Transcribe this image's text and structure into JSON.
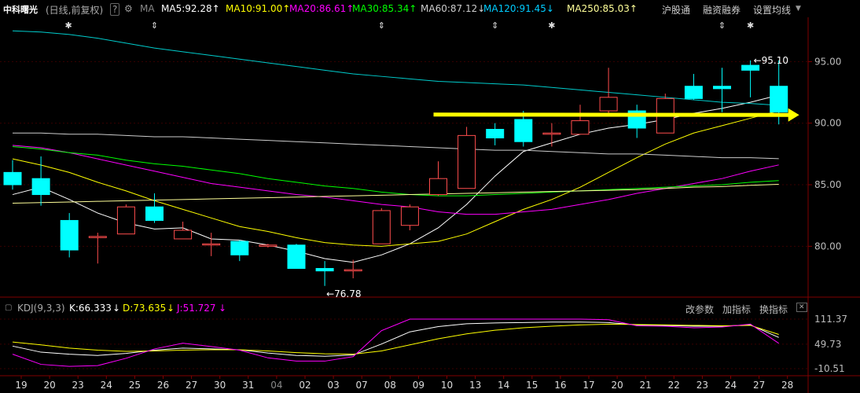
{
  "header": {
    "title": "中科曙光",
    "mode": "(日线,前复权)",
    "help_icon": "?",
    "settings_icon": "gear-icon",
    "ma_label": "MA",
    "ma": [
      {
        "label": "MA5:92.28",
        "arrow": "↑",
        "color": "#ffffff"
      },
      {
        "label": "MA10:91.00",
        "arrow": "↑",
        "color": "#ffff00"
      },
      {
        "label": "MA20:86.61",
        "arrow": "↑",
        "color": "#ff00ff"
      },
      {
        "label": "MA30:85.34",
        "arrow": "↑",
        "color": "#00ff00"
      },
      {
        "label": "MA60:87.12",
        "arrow": "↓",
        "color": "#cccccc"
      },
      {
        "label": "MA120:91.45",
        "arrow": "↓",
        "color": "#00ccff"
      },
      {
        "label": "MA250:85.03",
        "arrow": "↑",
        "color": "#ffff99"
      }
    ],
    "links": [
      "沪股通",
      "融资融券",
      "设置均线"
    ]
  },
  "indicator": {
    "name": "KDJ(9,3,3)",
    "k": "K:66.333",
    "k_arrow": "↓",
    "d": "D:73.635",
    "d_arrow": "↓",
    "j": "J:51.727",
    "j_arrow": "↓",
    "buttons": [
      "改参数",
      "加指标",
      "换指标"
    ]
  },
  "colors": {
    "up": "#ff4d4d",
    "down": "#00ffff",
    "arrow": "#ffff00"
  },
  "chart_data": {
    "type": "candlestick",
    "x_labels": [
      "19",
      "20",
      "23",
      "24",
      "25",
      "26",
      "27",
      "30",
      "31",
      "04",
      "02",
      "03",
      "07",
      "08",
      "09",
      "10",
      "13",
      "14",
      "15",
      "16",
      "17",
      "20",
      "21",
      "22",
      "23",
      "24",
      "27",
      "28"
    ],
    "y_ticks": [
      80.0,
      85.0,
      90.0,
      95.0
    ],
    "ylim": [
      76.0,
      98.6
    ],
    "annotations": {
      "max": "95.10",
      "min": "76.78",
      "max_arrow": "←",
      "min_arrow": "←"
    },
    "markers": [
      "✱",
      "⇕",
      "⇕",
      "⇕",
      "✱",
      "⇕",
      "✱"
    ],
    "candles": [
      {
        "o": 86.0,
        "h": 87.0,
        "l": 84.6,
        "c": 85.0
      },
      {
        "o": 85.5,
        "h": 87.3,
        "l": 83.3,
        "c": 84.2
      },
      {
        "o": 82.1,
        "h": 82.7,
        "l": 79.1,
        "c": 79.7
      },
      {
        "o": 80.8,
        "h": 81.1,
        "l": 78.6,
        "c": 80.8
      },
      {
        "o": 81.0,
        "h": 83.4,
        "l": 81.0,
        "c": 83.2
      },
      {
        "o": 83.2,
        "h": 84.3,
        "l": 81.9,
        "c": 82.1
      },
      {
        "o": 80.6,
        "h": 82.0,
        "l": 80.6,
        "c": 81.3
      },
      {
        "o": 80.2,
        "h": 81.1,
        "l": 79.2,
        "c": 80.2
      },
      {
        "o": 80.4,
        "h": 80.5,
        "l": 78.8,
        "c": 79.3
      },
      {
        "o": 80.0,
        "h": 80.2,
        "l": 79.9,
        "c": 80.1
      },
      {
        "o": 80.1,
        "h": 80.2,
        "l": 78.2,
        "c": 78.2
      },
      {
        "o": 78.2,
        "h": 78.8,
        "l": 76.78,
        "c": 78.0
      },
      {
        "o": 78.0,
        "h": 78.9,
        "l": 77.4,
        "c": 78.1
      },
      {
        "o": 80.2,
        "h": 83.1,
        "l": 80.2,
        "c": 82.9
      },
      {
        "o": 81.7,
        "h": 83.4,
        "l": 81.3,
        "c": 83.2
      },
      {
        "o": 84.2,
        "h": 86.9,
        "l": 84.1,
        "c": 85.5
      },
      {
        "o": 84.7,
        "h": 89.7,
        "l": 84.7,
        "c": 89.0
      },
      {
        "o": 89.5,
        "h": 90.0,
        "l": 88.2,
        "c": 88.8
      },
      {
        "o": 90.3,
        "h": 91.0,
        "l": 88.1,
        "c": 88.5
      },
      {
        "o": 89.1,
        "h": 90.0,
        "l": 88.1,
        "c": 89.2
      },
      {
        "o": 89.1,
        "h": 91.5,
        "l": 89.1,
        "c": 90.2
      },
      {
        "o": 91.0,
        "h": 94.5,
        "l": 90.7,
        "c": 92.1
      },
      {
        "o": 91.0,
        "h": 91.5,
        "l": 88.8,
        "c": 89.6
      },
      {
        "o": 89.2,
        "h": 92.4,
        "l": 89.2,
        "c": 92.0
      },
      {
        "o": 93.0,
        "h": 94.0,
        "l": 91.9,
        "c": 92.0
      },
      {
        "o": 93.0,
        "h": 94.5,
        "l": 90.9,
        "c": 92.8
      },
      {
        "o": 94.7,
        "h": 95.1,
        "l": 92.1,
        "c": 94.3
      },
      {
        "o": 93.0,
        "h": 95.1,
        "l": 89.9,
        "c": 90.9
      }
    ],
    "ma_lines": {
      "MA5": [
        84.2,
        84.8,
        83.8,
        82.7,
        81.9,
        81.4,
        81.5,
        80.6,
        80.5,
        80.1,
        79.6,
        79.0,
        78.7,
        79.3,
        80.2,
        81.5,
        83.4,
        85.7,
        87.7,
        88.4,
        89.1,
        89.6,
        89.9,
        90.3,
        90.8,
        91.2,
        91.7,
        92.28
      ],
      "MA10": [
        87.1,
        86.6,
        86.0,
        85.2,
        84.5,
        83.7,
        83.0,
        82.3,
        81.6,
        81.2,
        80.7,
        80.3,
        80.1,
        80.0,
        80.2,
        80.4,
        81.0,
        82.0,
        83.0,
        83.8,
        84.8,
        86.0,
        87.2,
        88.3,
        89.2,
        89.8,
        90.4,
        91.0
      ],
      "MA20": [
        88.2,
        88.0,
        87.6,
        87.1,
        86.6,
        86.1,
        85.6,
        85.1,
        84.8,
        84.5,
        84.2,
        84.0,
        83.7,
        83.4,
        83.2,
        82.8,
        82.6,
        82.6,
        82.8,
        83.0,
        83.4,
        83.8,
        84.3,
        84.7,
        85.1,
        85.5,
        86.1,
        86.61
      ],
      "MA30": [
        88.1,
        87.9,
        87.6,
        87.4,
        87.0,
        86.7,
        86.5,
        86.2,
        85.9,
        85.5,
        85.2,
        84.9,
        84.7,
        84.4,
        84.2,
        84.1,
        84.1,
        84.2,
        84.3,
        84.4,
        84.5,
        84.6,
        84.7,
        84.8,
        84.9,
        85.0,
        85.2,
        85.34
      ],
      "MA60": [
        89.2,
        89.2,
        89.1,
        89.1,
        89.0,
        88.9,
        88.9,
        88.8,
        88.7,
        88.6,
        88.5,
        88.4,
        88.3,
        88.2,
        88.1,
        88.0,
        87.9,
        87.8,
        87.8,
        87.7,
        87.6,
        87.5,
        87.5,
        87.4,
        87.3,
        87.2,
        87.2,
        87.12
      ],
      "MA120": [
        97.5,
        97.4,
        97.2,
        96.9,
        96.5,
        96.1,
        95.8,
        95.5,
        95.2,
        94.9,
        94.6,
        94.3,
        94.0,
        93.8,
        93.6,
        93.4,
        93.3,
        93.2,
        93.1,
        92.9,
        92.7,
        92.5,
        92.3,
        92.1,
        91.9,
        91.7,
        91.6,
        91.45
      ],
      "MA250": [
        83.5,
        83.55,
        83.6,
        83.65,
        83.7,
        83.75,
        83.8,
        83.85,
        83.9,
        83.95,
        84.0,
        84.05,
        84.1,
        84.15,
        84.2,
        84.25,
        84.3,
        84.35,
        84.4,
        84.45,
        84.5,
        84.55,
        84.6,
        84.7,
        84.8,
        84.85,
        84.95,
        85.03
      ]
    },
    "trend_arrow": {
      "from_index": 15,
      "to_index": 27.5,
      "y": 90.7
    },
    "kdj": {
      "y_ticks": [
        "111.37",
        "49.73",
        "-10.51"
      ],
      "ylim": [
        -10.51,
        111.37
      ],
      "K": [
        45,
        30,
        25,
        22,
        27,
        35,
        40,
        38,
        36,
        28,
        22,
        20,
        23,
        50,
        80,
        93,
        100,
        102,
        103,
        104,
        104,
        103,
        97,
        96,
        94,
        94,
        97,
        66.333
      ],
      "D": [
        55,
        48,
        40,
        35,
        32,
        33,
        35,
        36,
        36,
        33,
        29,
        26,
        25,
        33,
        48,
        63,
        75,
        84,
        90,
        94,
        97,
        99,
        98,
        97,
        96,
        95,
        96,
        73.635
      ],
      "J": [
        25,
        0,
        -5,
        -3,
        15,
        38,
        52,
        44,
        35,
        16,
        8,
        8,
        19,
        83,
        124,
        150,
        150,
        150,
        130,
        120,
        115,
        110,
        95,
        94,
        90,
        92,
        99,
        51.727
      ]
    }
  }
}
